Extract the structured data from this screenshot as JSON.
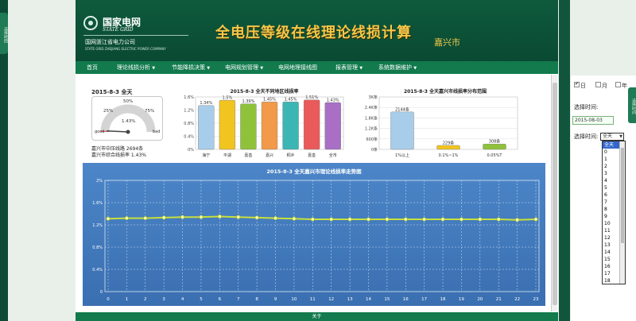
{
  "header": {
    "logo_cn": "国家电网",
    "logo_en": "STATE GRID",
    "company": "国网浙江省电力公司",
    "company_en": "STATE GRID ZHEJIANG ELECTRIC POWER COMPANY",
    "title": "全电压等级在线理论线损计算",
    "city": "嘉兴市"
  },
  "left_tab_label": "选择時間",
  "right_tab_label": "选择时间",
  "nav": {
    "items": [
      {
        "label": "首页",
        "caret": ""
      },
      {
        "label": "理论线损分析",
        "caret": "▼"
      },
      {
        "label": "节能降损决策",
        "caret": "▼"
      },
      {
        "label": "电网规划管理",
        "caret": "▼"
      },
      {
        "label": "电网地理接线图",
        "caret": ""
      },
      {
        "label": "报表管理",
        "caret": "▼"
      },
      {
        "label": "系统数据维护",
        "caret": "▼"
      }
    ]
  },
  "gauge": {
    "title": "2015-8-3 全天",
    "value": 1.43,
    "value_label": "1.43%",
    "ticks": [
      "25%",
      "50%",
      "75%"
    ],
    "good_label": "good",
    "bad_label": "bad"
  },
  "stats": {
    "line1": "嘉兴市中压线路 2694条",
    "line2": "嘉兴市综合线损率 1.43%"
  },
  "footer": {
    "label": "关于"
  },
  "panel": {
    "radios": [
      {
        "label": "日",
        "checked": true
      },
      {
        "label": "月",
        "checked": false
      },
      {
        "label": "年",
        "checked": false
      }
    ],
    "select_time_label": "选择时间:",
    "date_value": "2015-08-03",
    "select_time_label2": "选择时间:",
    "select_value": "全天",
    "select_caret": "▼",
    "options": [
      "全天",
      "0",
      "1",
      "2",
      "3",
      "4",
      "5",
      "6",
      "7",
      "8",
      "9",
      "10",
      "11",
      "12",
      "13",
      "14",
      "15",
      "16",
      "17",
      "18"
    ]
  },
  "colors": {
    "header_bg": "#0e5a3d",
    "nav_bg": "#127a4d",
    "title_gold": "#f3c84b",
    "trend_bg": "#3a72b8",
    "trend_line": "#c8e03a"
  },
  "chart_data": [
    {
      "type": "bar",
      "title": "2015-8-3 全天不同地区线损率",
      "categories": [
        "海宁",
        "平湖",
        "嘉善",
        "嘉兴",
        "桐乡",
        "嘉善",
        "全市"
      ],
      "values": [
        1.34,
        1.5,
        1.39,
        1.45,
        1.45,
        1.51,
        1.43
      ],
      "value_labels": [
        "1.34%",
        "1.5%",
        "1.39%",
        "1.45%",
        "1.45%",
        "1.51%",
        "1.43%"
      ],
      "colors": [
        "#a8cdea",
        "#f2c420",
        "#8fc23a",
        "#f29a4a",
        "#3cb6b4",
        "#ea5a5a",
        "#a86fc4"
      ],
      "ylim": [
        0,
        1.6
      ],
      "yticks": [
        0,
        0.4,
        0.8,
        1.2,
        1.6
      ],
      "ytick_labels": [
        "0%",
        "0.4%",
        "0.8%",
        "1.2%",
        "1.6%"
      ],
      "grid": true
    },
    {
      "type": "bar",
      "title": "2015-8-3 全天嘉兴市线损率分布范围",
      "categories": [
        "1%以上",
        "0.1%~1%",
        "0.05%T"
      ],
      "values": [
        2144,
        229,
        308
      ],
      "value_labels": [
        "2144条",
        "229条",
        "308条"
      ],
      "colors": [
        "#a8cdea",
        "#f2c420",
        "#8fc23a"
      ],
      "ylim": [
        0,
        3000
      ],
      "yticks": [
        0,
        600,
        1200,
        1800,
        2400,
        3000
      ],
      "ytick_labels": [
        "0条",
        "600条",
        "1.2K条",
        "1.8K条",
        "2.4K条",
        "3K条"
      ],
      "grid": true
    },
    {
      "type": "line",
      "title": "2015-8-3 全天嘉兴市理论线损率走势图",
      "x": [
        0,
        1,
        2,
        3,
        4,
        5,
        6,
        7,
        8,
        9,
        10,
        11,
        12,
        13,
        14,
        15,
        16,
        17,
        18,
        19,
        20,
        21,
        22,
        23
      ],
      "values": [
        1.31,
        1.32,
        1.32,
        1.33,
        1.34,
        1.34,
        1.35,
        1.34,
        1.33,
        1.32,
        1.31,
        1.3,
        1.3,
        1.3,
        1.3,
        1.3,
        1.3,
        1.3,
        1.3,
        1.3,
        1.3,
        1.3,
        1.29,
        1.3
      ],
      "ylim": [
        0,
        2
      ],
      "yticks": [
        0,
        0.4,
        0.8,
        1.2,
        1.6,
        2
      ],
      "ytick_labels": [
        "0",
        "0.4%",
        "0.8%",
        "1.2%",
        "1.6%",
        "2%"
      ],
      "grid": true
    }
  ]
}
